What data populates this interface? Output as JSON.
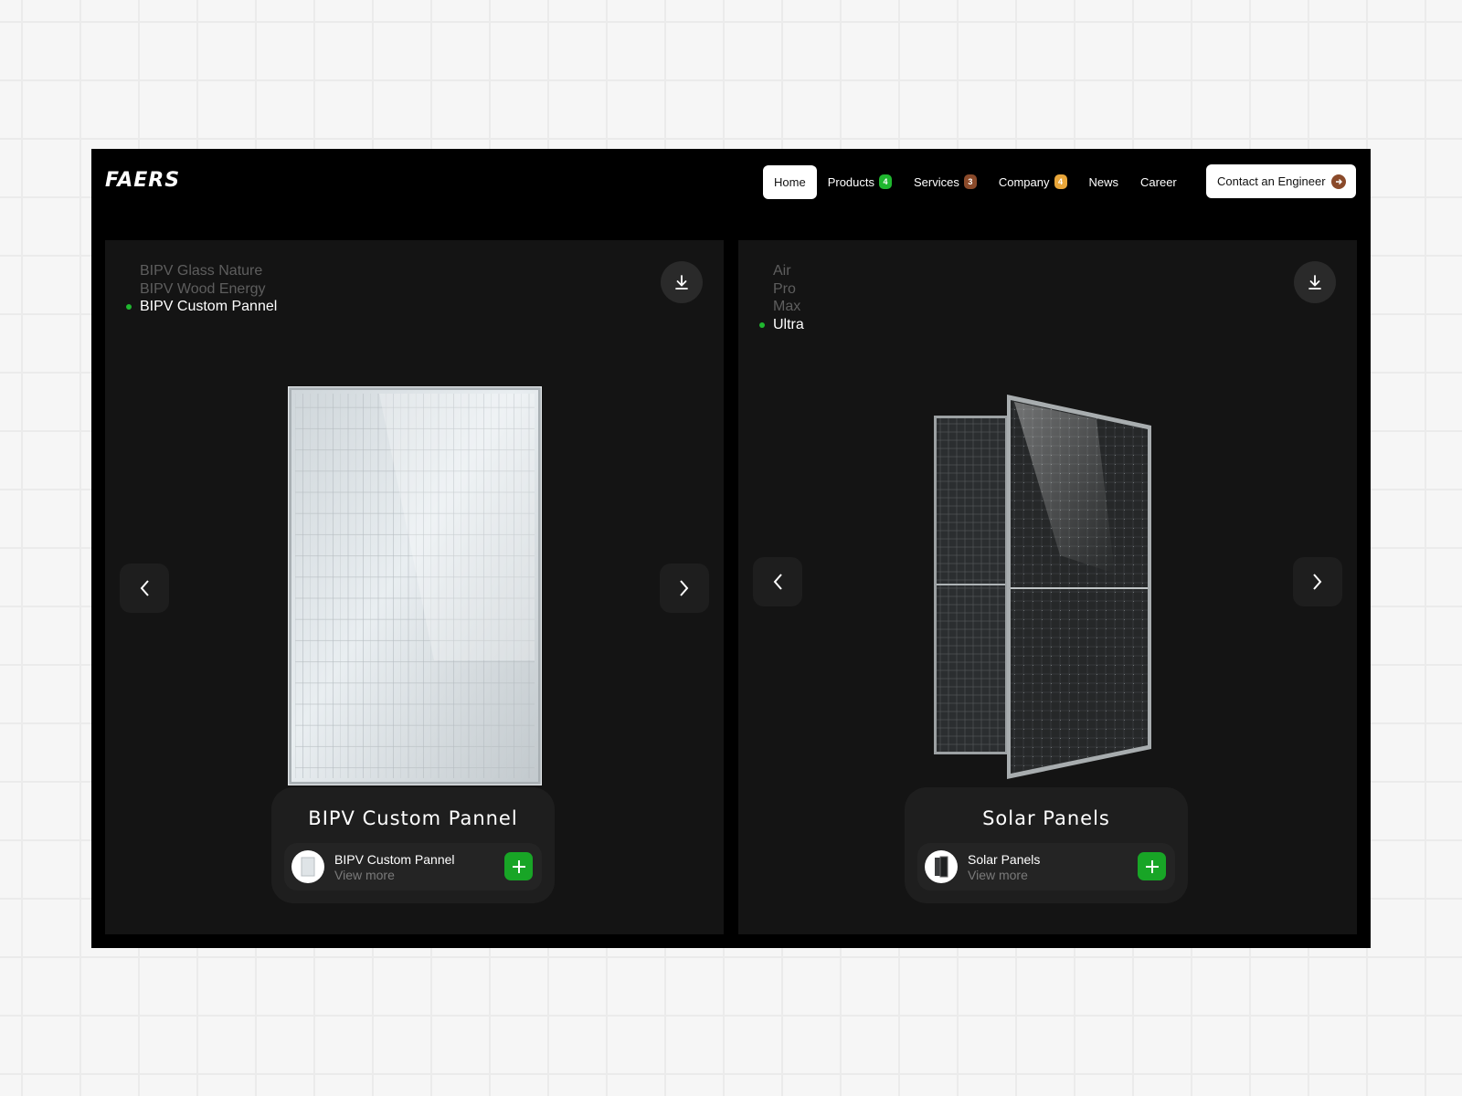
{
  "brand": {
    "logo_text": "FAERS"
  },
  "nav": {
    "items": [
      {
        "label": "Home",
        "active": true
      },
      {
        "label": "Products",
        "badge": "4",
        "badge_color": "#1fb72f"
      },
      {
        "label": "Services",
        "badge": "3",
        "badge_color": "#8a4a2a"
      },
      {
        "label": "Company",
        "badge": "4",
        "badge_color": "#e8a63a"
      },
      {
        "label": "News"
      },
      {
        "label": "Career"
      }
    ],
    "cta_label": "Contact an Engineer",
    "cta_arrow_color": "#8a4a2a"
  },
  "panels": [
    {
      "variants": [
        "BIPV Glass Nature",
        "BIPV Wood Energy",
        "BIPV Custom Pannel"
      ],
      "active_variant": 2,
      "card_title": "BIPV Custom Pannel",
      "row_title": "BIPV Custom Pannel",
      "row_sub": "View more",
      "icons": {
        "download": "download-icon",
        "prev": "chevron-left-icon",
        "next": "chevron-right-icon",
        "add": "plus-icon"
      }
    },
    {
      "variants": [
        "Air",
        "Pro",
        "Max",
        "Ultra"
      ],
      "active_variant": 3,
      "card_title": "Solar Panels",
      "row_title": "Solar Panels",
      "row_sub": "View more",
      "icons": {
        "download": "download-icon",
        "prev": "chevron-left-icon",
        "next": "chevron-right-icon",
        "add": "plus-icon"
      }
    }
  ],
  "colors": {
    "accent_green": "#1fb72f",
    "frame_bg": "#000000",
    "panel_bg": "#141414"
  }
}
